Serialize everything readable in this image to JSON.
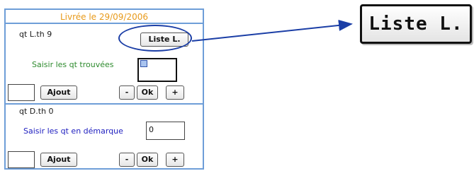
{
  "header": {
    "title": "Livrée le 29/09/2006"
  },
  "section_l": {
    "qty_label": "qt L.th 9",
    "list_button": "Liste L.",
    "prompt": "Saisir les qt trouvées",
    "checkbox_checked": true,
    "add_value": "",
    "add_button": "Ajout",
    "minus_button": "-",
    "ok_button": "Ok",
    "plus_button": "+"
  },
  "section_d": {
    "qty_label": "qt D.th 0",
    "prompt": "Saisir les qt en démarque",
    "input_value": "0",
    "add_value": "",
    "add_button": "Ajout",
    "minus_button": "-",
    "ok_button": "Ok",
    "plus_button": "+"
  },
  "zoom": {
    "button_label": "Liste L."
  },
  "colors": {
    "panel_border": "#6e9ed8",
    "title_text": "#e89a1a",
    "prompt_green": "#2e8b2e",
    "prompt_blue": "#2020c0",
    "annotation": "#1b3ea6"
  }
}
